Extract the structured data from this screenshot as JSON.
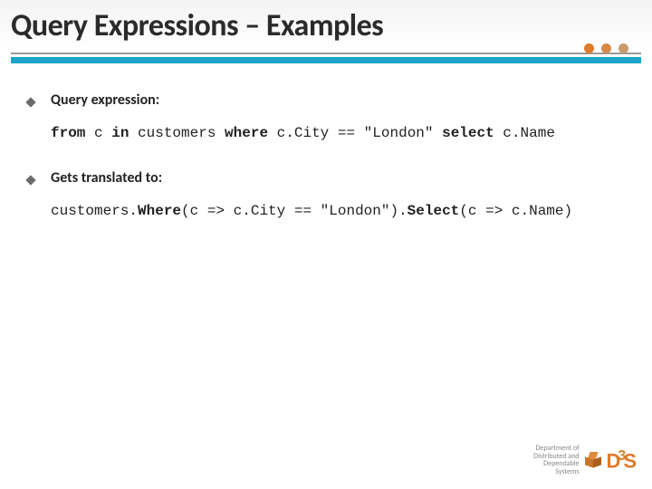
{
  "title": "Query Expressions – Examples",
  "bullets": [
    {
      "label": "Query expression:"
    },
    {
      "label": "Gets translated to:"
    }
  ],
  "code1": {
    "kw_from": "from",
    "t1": " c ",
    "kw_in": "in",
    "t2": " customers ",
    "kw_where": "where",
    "t3": " c.City == \"London\" ",
    "kw_select": "select",
    "t4": " c.Name"
  },
  "code2": {
    "t1": "customers.",
    "kw_where": "Where",
    "t2": "(c => c.City == \"London\").",
    "kw_select": "Select",
    "t3": "(c => c.Name)"
  },
  "footer": {
    "line1": "Department of",
    "line2": "Distributed and",
    "line3": "Dependable",
    "line4": "Systems"
  },
  "logo": {
    "d": "D",
    "three": "3",
    "s": "S"
  }
}
